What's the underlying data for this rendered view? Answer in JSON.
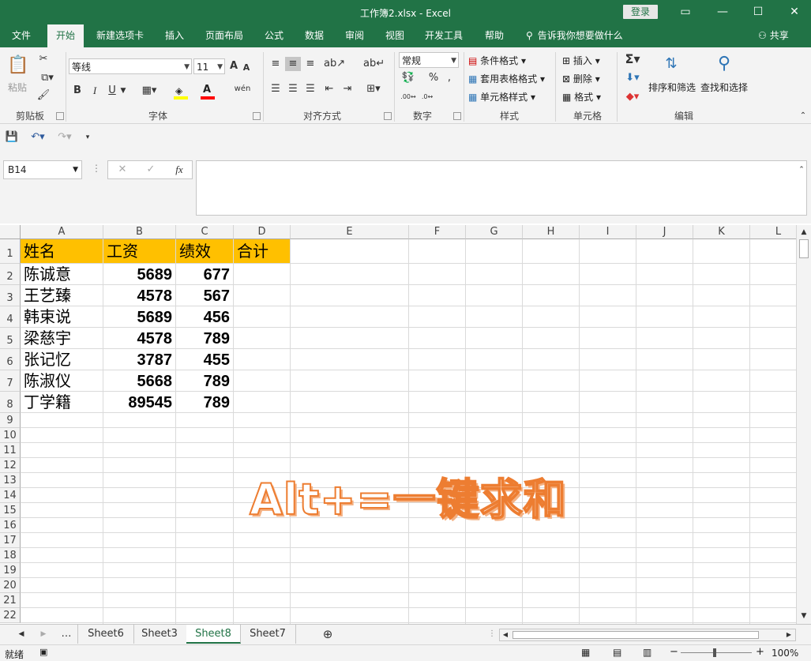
{
  "window": {
    "title": "工作簿2.xlsx  -  Excel",
    "login": "登录",
    "controls": [
      "▭",
      "—",
      "☐",
      "✕"
    ]
  },
  "tabs": [
    "文件",
    "开始",
    "新建选项卡",
    "插入",
    "页面布局",
    "公式",
    "数据",
    "审阅",
    "视图",
    "开发工具",
    "帮助"
  ],
  "active_tab": "开始",
  "tell_me": "告诉我你想要做什么",
  "share": "共享",
  "ribbon": {
    "clipboard": {
      "paste": "粘贴",
      "label": "剪贴板"
    },
    "font": {
      "name": "等线",
      "size": "11",
      "grow": "A",
      "shrink": "A",
      "bold": "B",
      "italic": "I",
      "underline": "U",
      "phonetic": "wén",
      "label": "字体"
    },
    "alignment": {
      "label": "对齐方式"
    },
    "number": {
      "format": "常规",
      "percent": "%",
      "comma": ",",
      "label": "数字"
    },
    "styles": {
      "conditional": "条件格式",
      "table": "套用表格格式",
      "cell": "单元格样式",
      "label": "样式"
    },
    "cells": {
      "insert": "插入",
      "delete": "删除",
      "format": "格式",
      "label": "单元格"
    },
    "editing": {
      "sort": "排序和筛选",
      "find": "查找和选择",
      "label": "编辑"
    }
  },
  "formula_bar": {
    "name_box": "B14",
    "value": ""
  },
  "columns": [
    "A",
    "B",
    "C",
    "D",
    "E",
    "F",
    "G",
    "H",
    "I",
    "J",
    "K",
    "L"
  ],
  "rows": [
    "1",
    "2",
    "3",
    "4",
    "5",
    "6",
    "7",
    "8",
    "9",
    "10",
    "11",
    "12",
    "13",
    "14",
    "15",
    "16",
    "17",
    "18",
    "19",
    "20",
    "21",
    "22"
  ],
  "sheet": {
    "headers": [
      "姓名",
      "工资",
      "绩效",
      "合计"
    ],
    "data": [
      [
        "陈诚意",
        "5689",
        "677"
      ],
      [
        "王艺臻",
        "4578",
        "567"
      ],
      [
        "韩束说",
        "5689",
        "456"
      ],
      [
        "梁慈宇",
        "4578",
        "789"
      ],
      [
        "张记忆",
        "3787",
        "455"
      ],
      [
        "陈淑仪",
        "5668",
        "789"
      ],
      [
        "丁学籍",
        "89545",
        "789"
      ]
    ],
    "header_fill": "#FFC000"
  },
  "overlay_caption": "Alt+=一键求和",
  "sheet_tabs": [
    "Sheet6",
    "Sheet3",
    "Sheet8",
    "Sheet7"
  ],
  "active_sheet": "Sheet8",
  "status": {
    "ready": "就绪",
    "zoom": "100%"
  },
  "colors": {
    "brand": "#217346",
    "accent": "#ED7D31"
  }
}
